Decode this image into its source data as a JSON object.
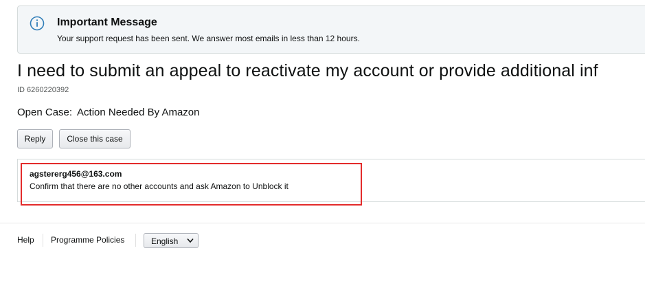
{
  "alert": {
    "icon": "info-icon",
    "title": "Important Message",
    "body": "Your support request has been sent. We answer most emails in less than 12 hours."
  },
  "case": {
    "title": "I need to submit an appeal to reactivate my account or provide additional inf",
    "id": "ID 6260220392",
    "status_label": "Open Case:",
    "status_value": "Action Needed By Amazon"
  },
  "actions": {
    "reply_label": "Reply",
    "close_label": "Close this case"
  },
  "message": {
    "sender": "agstererg456@163.com",
    "body": "Confirm that there are no other accounts and ask Amazon to Unblock it"
  },
  "footer": {
    "help_label": "Help",
    "policies_label": "Programme Policies",
    "language_selected": "English"
  },
  "colors": {
    "highlight_border": "#e32b2b",
    "alert_background": "#f3f6f8",
    "info_icon": "#2f7db8"
  }
}
